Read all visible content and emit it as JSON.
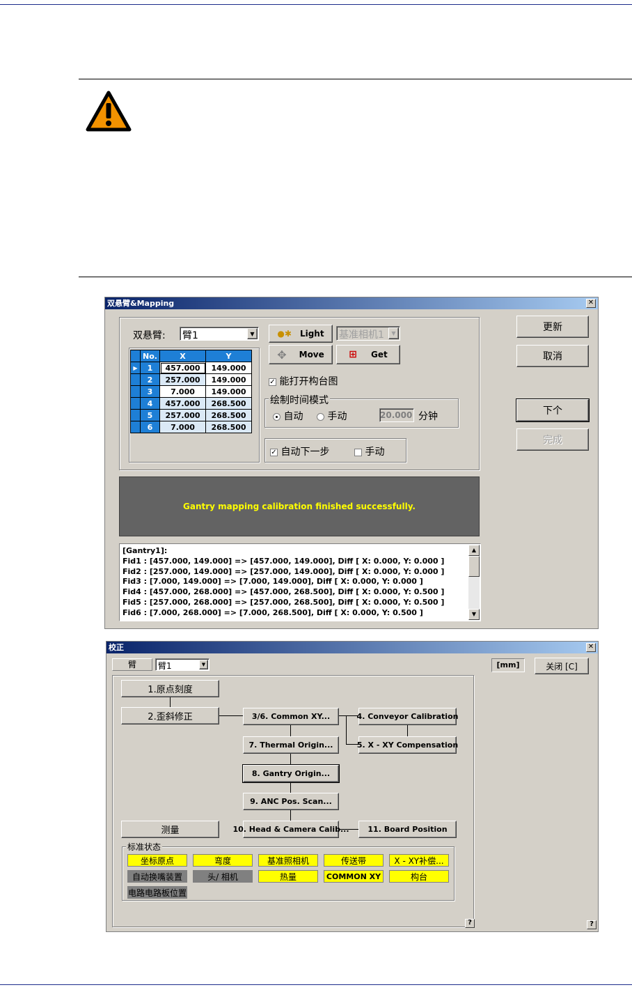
{
  "mapping_dialog": {
    "title": "双悬臂&Mapping",
    "gantry_label": "双悬臂:",
    "gantry_value": "臂1",
    "camera_select": "基准相机1",
    "buttons": {
      "light": "Light",
      "move": "Move",
      "get": "Get",
      "update": "更新",
      "cancel": "取消",
      "next": "下个",
      "finish": "完成"
    },
    "table": {
      "headers": [
        "No.",
        "X",
        "Y"
      ],
      "rows": [
        [
          "1",
          "457.000",
          "149.000"
        ],
        [
          "2",
          "257.000",
          "149.000"
        ],
        [
          "3",
          "7.000",
          "149.000"
        ],
        [
          "4",
          "457.000",
          "268.500"
        ],
        [
          "5",
          "257.000",
          "268.500"
        ],
        [
          "6",
          "7.000",
          "268.500"
        ]
      ]
    },
    "enable_map_check": "能打开构台图",
    "draw_mode_group": "绘制时间模式",
    "radio_auto": "自动",
    "radio_manual": "手动",
    "minutes_value": "20.000",
    "minutes_unit": "分钟",
    "auto_next_check": "自动下一步",
    "manual_check": "手动",
    "status_message": "Gantry mapping calibration finished successfully.",
    "log_lines": [
      "[Gantry1]:",
      "Fid1 : [457.000, 149.000] => [457.000, 149.000],  Diff [ X: 0.000, Y: 0.000 ]",
      "Fid2 : [257.000, 149.000] => [257.000, 149.000],  Diff [ X: 0.000, Y: 0.000 ]",
      "Fid3 : [7.000, 149.000] => [7.000, 149.000],  Diff [ X: 0.000, Y: 0.000 ]",
      "Fid4 : [457.000, 268.000] => [457.000, 268.500],  Diff [ X: 0.000, Y: 0.500 ]",
      "Fid5 : [257.000, 268.000] => [257.000, 268.500],  Diff [ X: 0.000, Y: 0.500 ]",
      "Fid6 : [7.000, 268.000] => [7.000, 268.500],  Diff [ X: 0.000, Y: 0.500 ]"
    ]
  },
  "calib_dialog": {
    "title": "校正",
    "arm_label": "臂",
    "arm_value": "臂1",
    "unit_label": "[mm]",
    "close_button": "关闭 [C]",
    "help": "?",
    "steps": {
      "s1": "1.原点刻度",
      "s2": "2.歪斜修正",
      "s36": "3/6. Common XY...",
      "s4": "4. Conveyor Calibration",
      "s5": "5. X - XY Compensation",
      "s7": "7. Thermal Origin...",
      "s8": "8. Gantry Origin...",
      "s9": "9. ANC Pos. Scan...",
      "s10": "10. Head & Camera Calib...",
      "s11": "11. Board Position",
      "measure": "测量"
    },
    "status_group": "标准状态",
    "status_tags": {
      "t1": "坐标原点",
      "t2": "弯度",
      "t3": "基准照相机",
      "t4": "传送带",
      "t5": "X - XY补偿...",
      "t6": "自动换嘴装置",
      "t7": "头/ 相机",
      "t8": "热量",
      "t9": "COMMON XY",
      "t10": "构台",
      "t11": "电路电路板位置"
    }
  },
  "colors": {
    "title_start": "#0a246a",
    "title_end": "#a6caf0",
    "status_yellow": "#ffff00",
    "status_gray": "#808080",
    "grid_blue": "#1e7fd6",
    "warning_orange": "#f39200"
  }
}
